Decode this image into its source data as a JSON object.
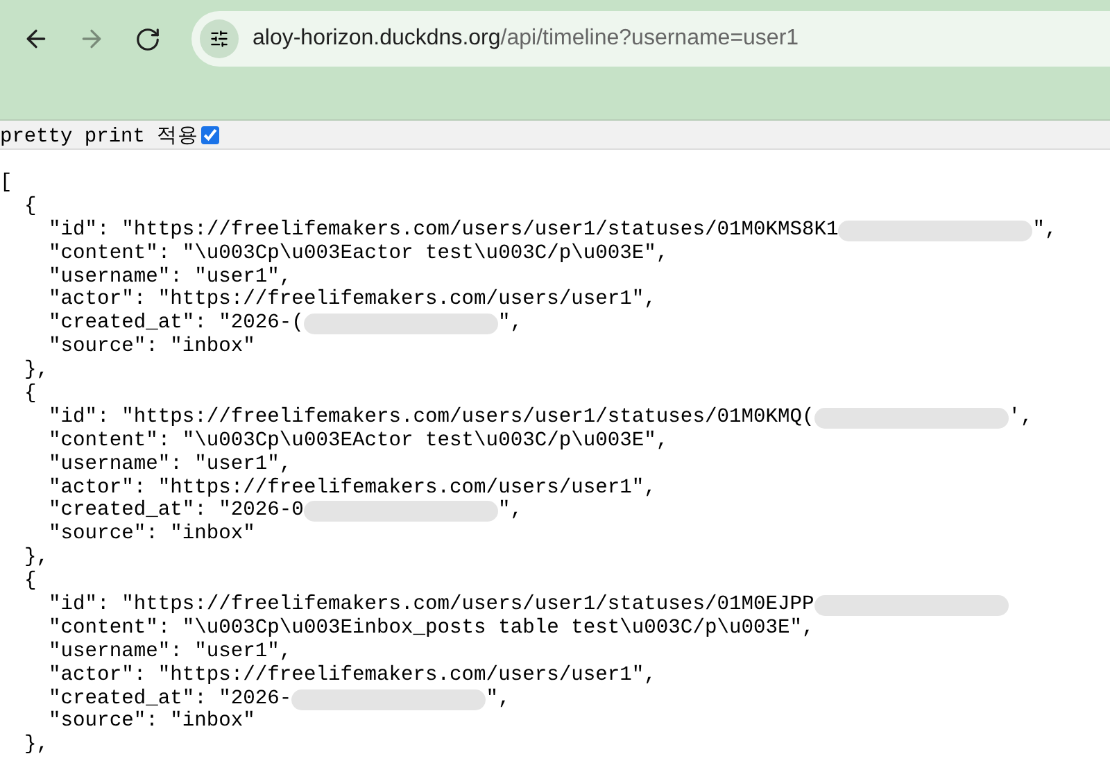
{
  "browser": {
    "url_host": "aloy-horizon.duckdns.org",
    "url_path": "/api/timeline?username=user1",
    "forward_disabled": true
  },
  "pretty_print": {
    "label": "pretty print 적용",
    "checked": true
  },
  "lines": [
    {
      "text": "["
    },
    {
      "text": "  {"
    },
    {
      "text": "    \"id\": \"https://freelifemakers.com/users/user1/statuses/01M0KMS8K1",
      "redacted": true,
      "tail": "\","
    },
    {
      "text": "    \"content\": \"\\u003Cp\\u003Eactor test\\u003C/p\\u003E\","
    },
    {
      "text": "    \"username\": \"user1\","
    },
    {
      "text": "    \"actor\": \"https://freelifemakers.com/users/user1\","
    },
    {
      "text": "    \"created_at\": \"2026-(",
      "redacted": true,
      "tail": "\","
    },
    {
      "text": "    \"source\": \"inbox\""
    },
    {
      "text": "  },"
    },
    {
      "text": "  {"
    },
    {
      "text": "    \"id\": \"https://freelifemakers.com/users/user1/statuses/01M0KMQ(",
      "redacted": true,
      "tail": "',"
    },
    {
      "text": "    \"content\": \"\\u003Cp\\u003EActor test\\u003C/p\\u003E\","
    },
    {
      "text": "    \"username\": \"user1\","
    },
    {
      "text": "    \"actor\": \"https://freelifemakers.com/users/user1\","
    },
    {
      "text": "    \"created_at\": \"2026-0",
      "redacted": true,
      "tail": "\","
    },
    {
      "text": "    \"source\": \"inbox\""
    },
    {
      "text": "  },"
    },
    {
      "text": "  {"
    },
    {
      "text": "    \"id\": \"https://freelifemakers.com/users/user1/statuses/01M0EJPP",
      "redacted": true
    },
    {
      "text": "    \"content\": \"\\u003Cp\\u003Einbox_posts table test\\u003C/p\\u003E\","
    },
    {
      "text": "    \"username\": \"user1\","
    },
    {
      "text": "    \"actor\": \"https://freelifemakers.com/users/user1\","
    },
    {
      "text": "    \"created_at\": \"2026-",
      "redacted": true,
      "tail": "\","
    },
    {
      "text": "    \"source\": \"inbox\""
    },
    {
      "text": "  },"
    }
  ]
}
